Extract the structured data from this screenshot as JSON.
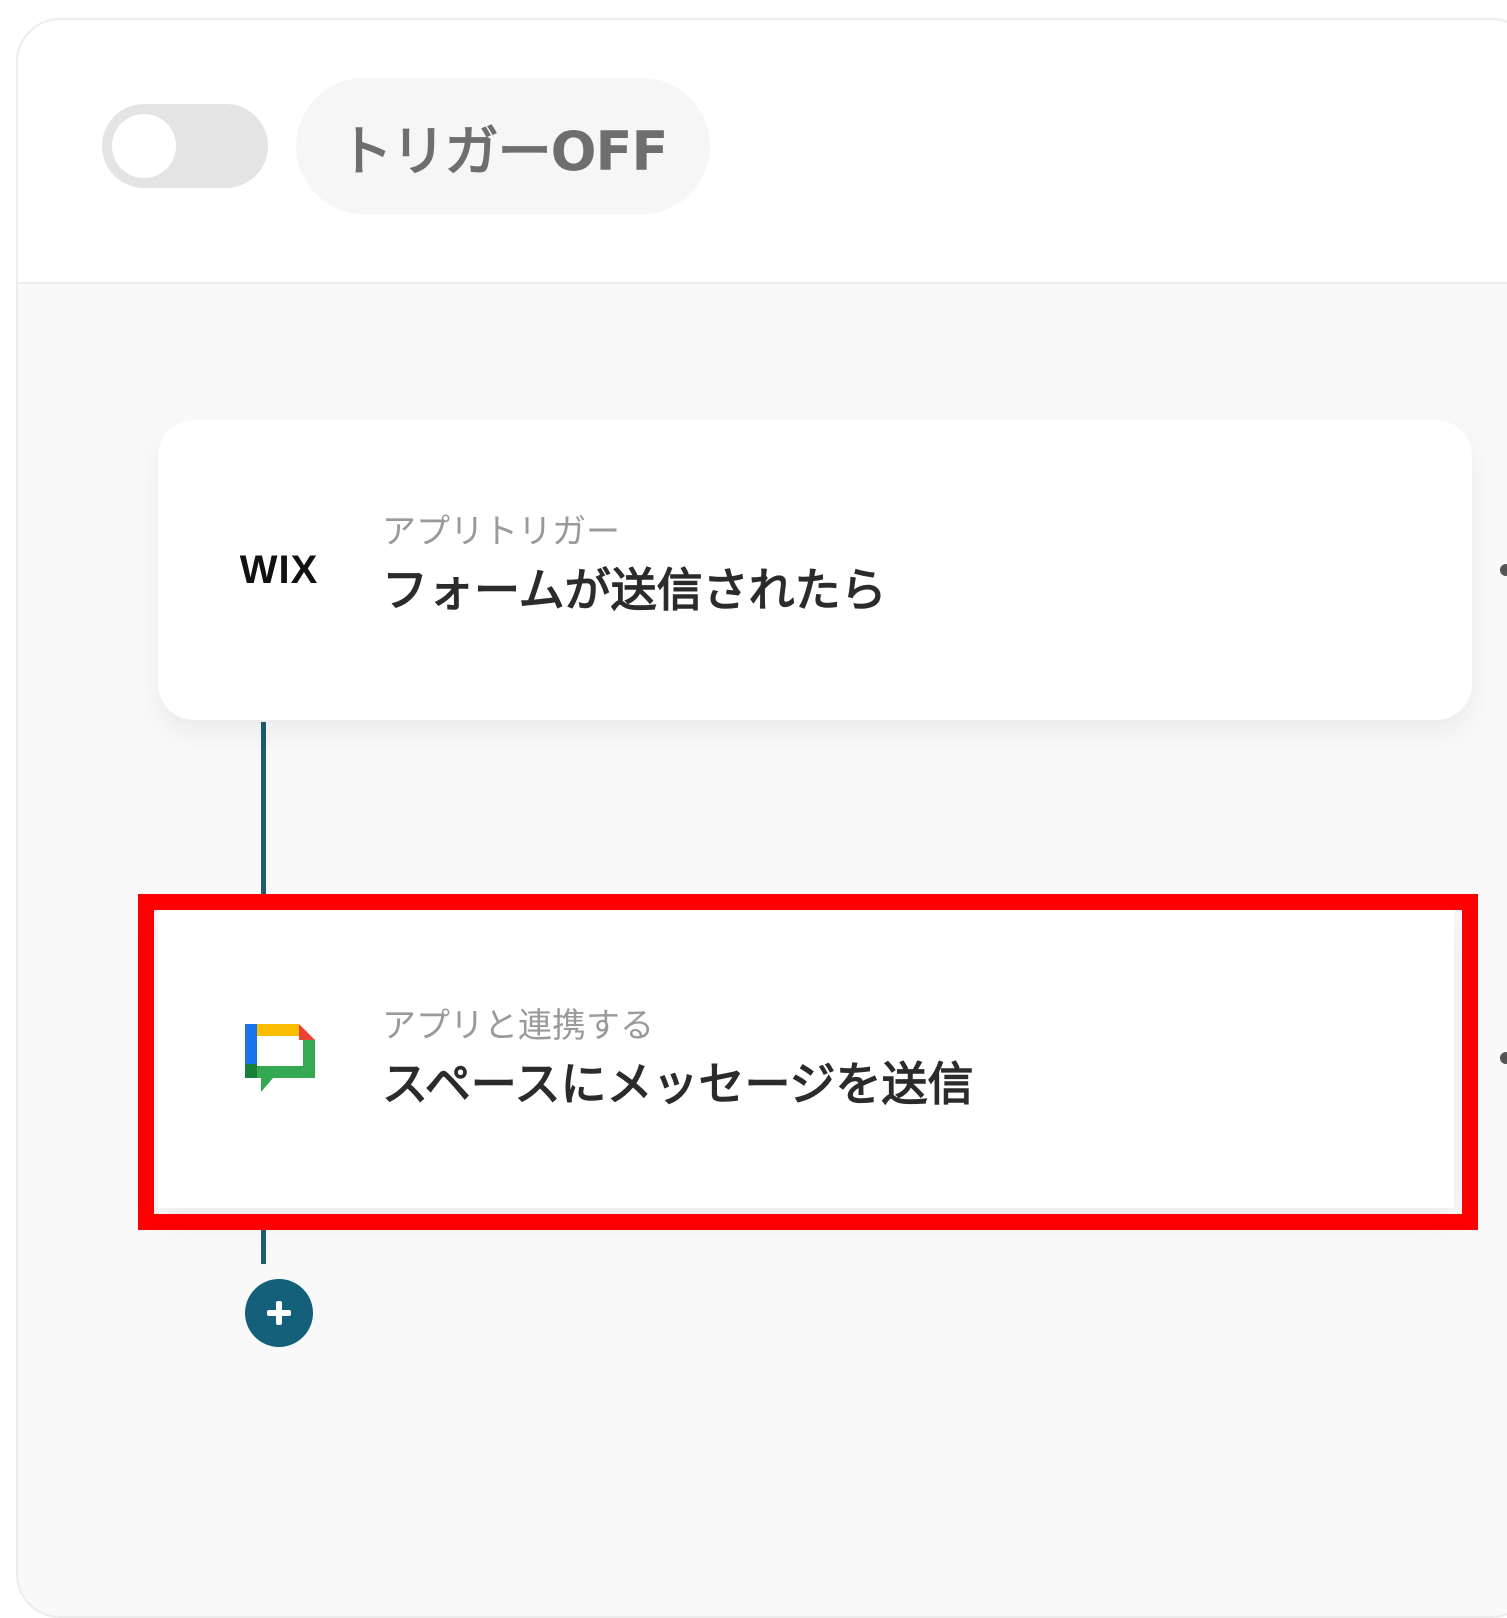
{
  "header": {
    "trigger_label": "トリガーOFF",
    "trigger_enabled": false
  },
  "flow": {
    "steps": [
      {
        "app_icon": "wix-logo",
        "icon_text": "WIX",
        "type_label": "アプリトリガー",
        "action_title": "フォームが送信されたら"
      },
      {
        "app_icon": "google-chat-icon",
        "type_label": "アプリと連携する",
        "action_title": "スペースにメッセージを送信",
        "highlighted": true
      }
    ]
  },
  "colors": {
    "connector": "#1d5c74",
    "add_button": "#14607a",
    "highlight": "#ff0000",
    "google_blue": "#1a73e8",
    "google_yellow": "#fbbc04",
    "google_green": "#34a853",
    "google_red": "#ea4335",
    "google_dark_green": "#188038"
  }
}
